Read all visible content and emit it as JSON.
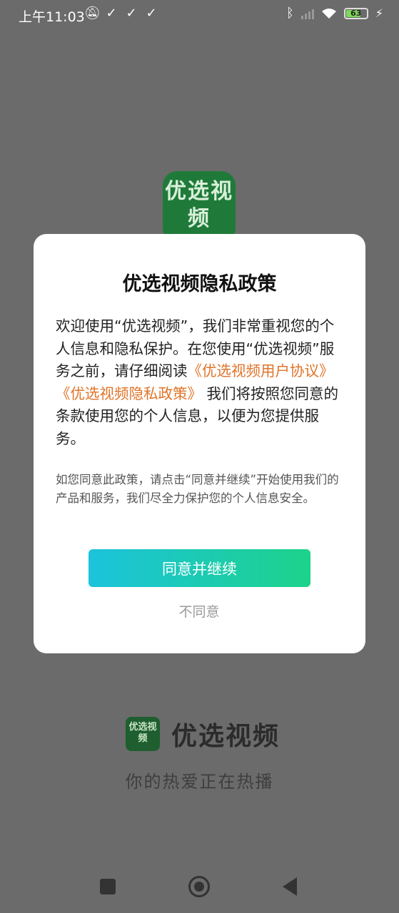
{
  "status_bar": {
    "time": "上午11:03",
    "left_icons": [
      "mute-bell-icon",
      "check-icon",
      "check-icon",
      "check-icon"
    ],
    "battery": "63"
  },
  "background": {
    "logo_text": "优选视频"
  },
  "dialog": {
    "title": "优选视频隐私政策",
    "body_part1": "欢迎使用“优选视频”，我们非常重视您的个人信息和隐私保护。在您使用“优选视频”服务之前，请仔细阅读",
    "link_agreement": "《优选视频用户协议》",
    "link_privacy": "《优选视频隐私政策》",
    "body_part2": " 我们将按照您同意的条款使用您的个人信息，以便为您提供服务。",
    "note": "如您同意此政策，请点击“同意并继续”开始使用我们的产品和服务，我们尽全力保护您的个人信息安全。",
    "agree_label": "同意并继续",
    "disagree_label": "不同意",
    "accent_color": "#e0742a"
  },
  "brand": {
    "logo_text": "优选视频",
    "name": "优选视频",
    "slogan": "你的热爱正在热播"
  }
}
